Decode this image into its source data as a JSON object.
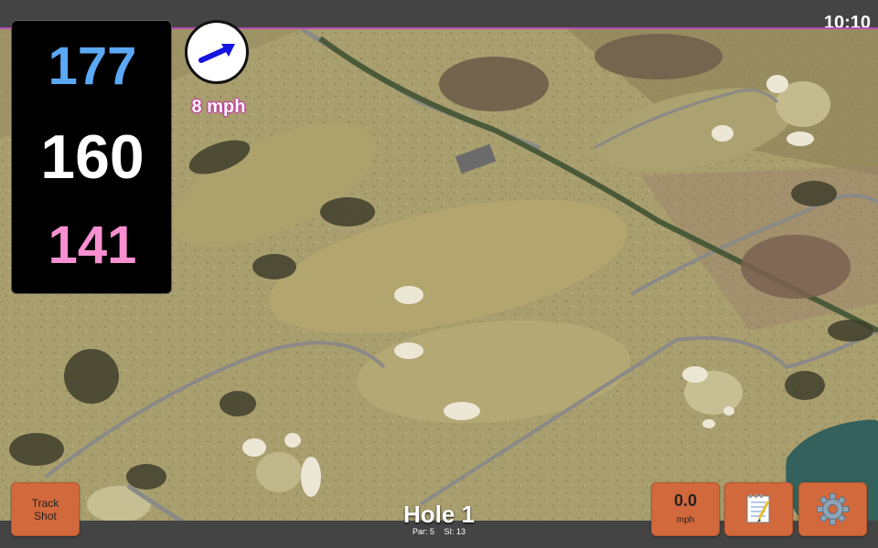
{
  "status": {
    "time": "10:10"
  },
  "distances": {
    "back": "177",
    "center": "160",
    "front": "141"
  },
  "wind": {
    "speed_label": "8 mph",
    "icon": "wind-arrow-icon",
    "arrow_color": "#1515e0"
  },
  "hole": {
    "title": "Hole 1",
    "par_label": "Par: 5",
    "si_label": "SI: 13"
  },
  "buttons": {
    "track_shot_line1": "Track",
    "track_shot_line2": "Shot",
    "speed_value": "0.0",
    "speed_unit": "mph",
    "notes_icon": "notepad-icon",
    "settings_icon": "gear-icon"
  },
  "colors": {
    "back_distance": "#5ba8f5",
    "center_distance": "#ffffff",
    "front_distance": "#f78fd0",
    "button": "#d2693c",
    "accent_border": "#b84fb1"
  }
}
